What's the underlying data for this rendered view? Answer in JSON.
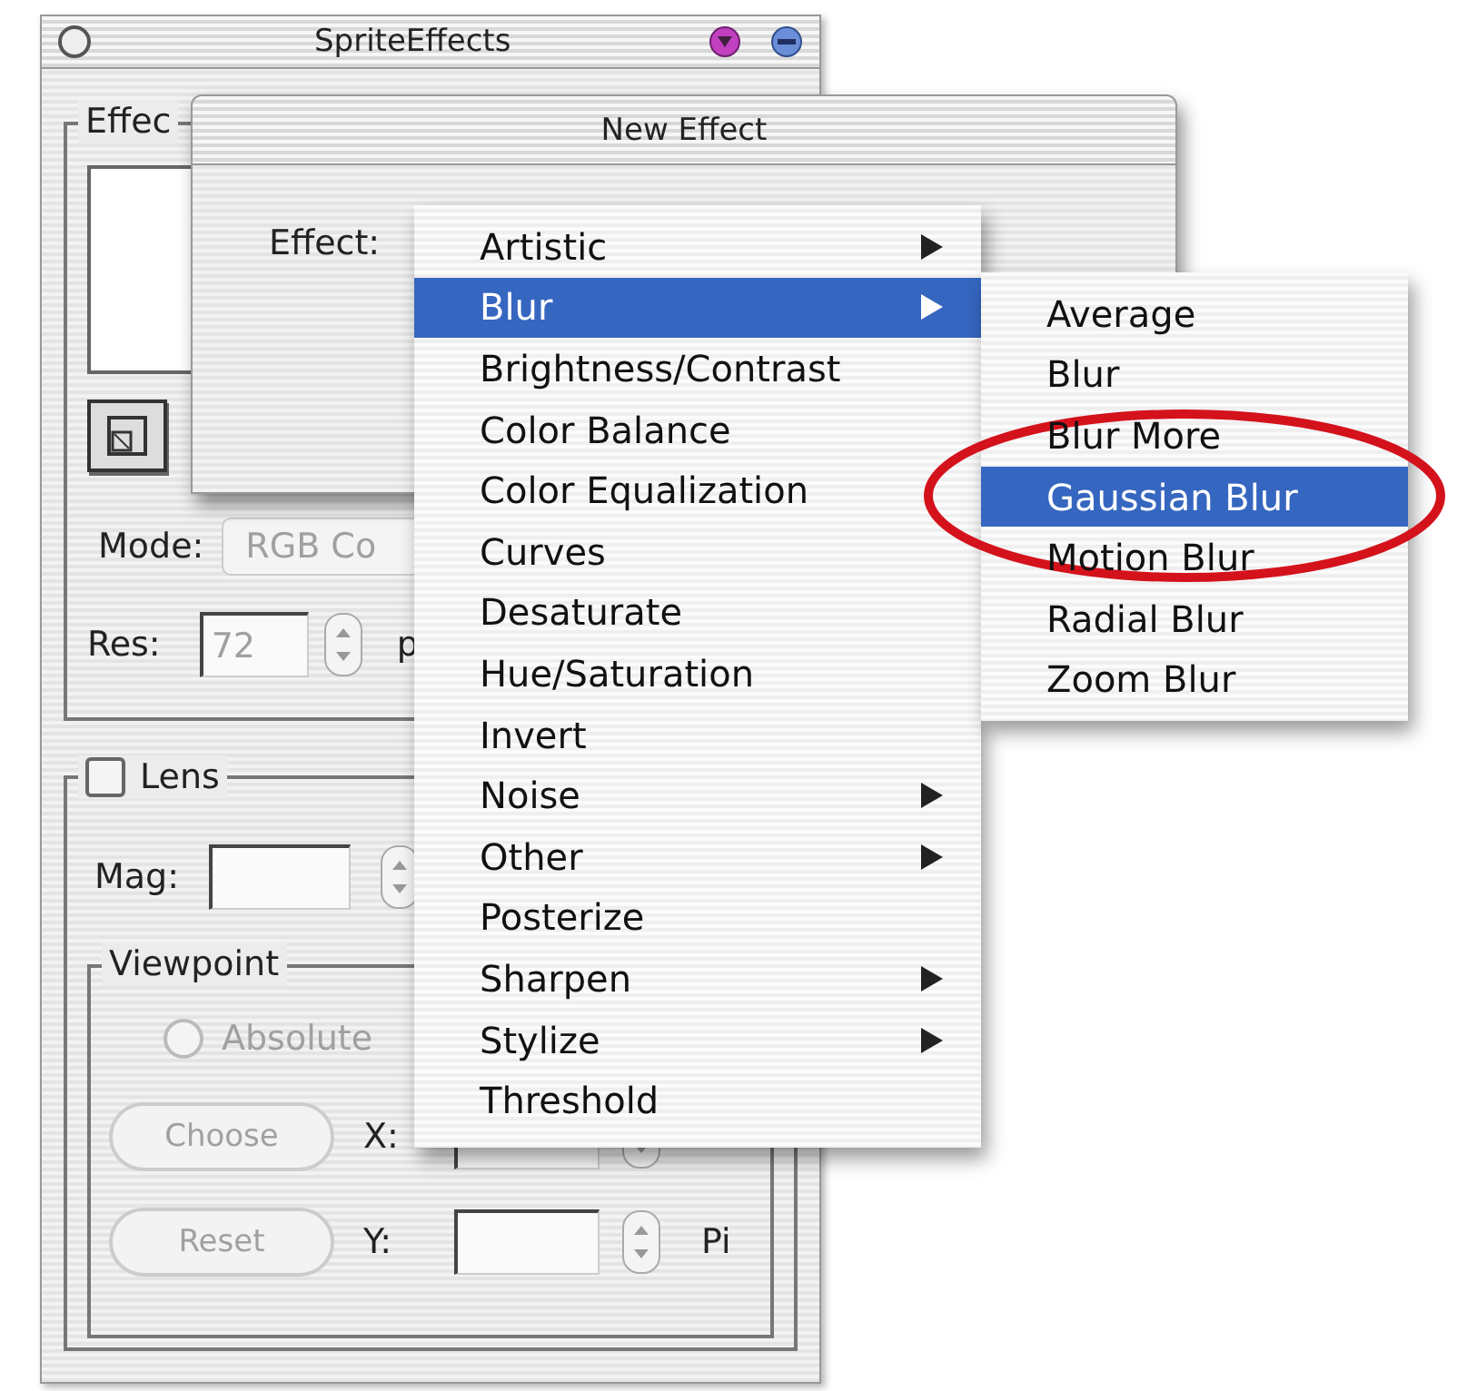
{
  "main_window": {
    "title": "SpriteEffects",
    "effect_group": {
      "label": "Effec"
    },
    "mode": {
      "label": "Mode:",
      "value": "RGB Co",
      "disabled": true
    },
    "res": {
      "label": "Res:",
      "value": "72",
      "unit": "p",
      "disabled": true
    },
    "lens": {
      "label": "Lens",
      "checked": false
    },
    "mag": {
      "label": "Mag:"
    },
    "viewpoint": {
      "label": "Viewpoint",
      "absolute": {
        "label": "Absolute",
        "selected": false,
        "disabled": true
      },
      "rows": [
        {
          "button": "Choose",
          "disabled": true,
          "axis": "X:"
        },
        {
          "button": "Reset",
          "disabled": true,
          "axis": "Y:",
          "unit": "Pi"
        }
      ]
    }
  },
  "dialog": {
    "title": "New Effect",
    "effect_label": "Effect:"
  },
  "menu": {
    "items": [
      {
        "label": "Artistic",
        "selected": false,
        "has_submenu": true
      },
      {
        "label": "Blur",
        "selected": true,
        "has_submenu": true
      },
      {
        "label": "Brightness/Contrast",
        "selected": false,
        "has_submenu": false
      },
      {
        "label": "Color Balance",
        "selected": false,
        "has_submenu": false
      },
      {
        "label": "Color Equalization",
        "selected": false,
        "has_submenu": false
      },
      {
        "label": "Curves",
        "selected": false,
        "has_submenu": false
      },
      {
        "label": "Desaturate",
        "selected": false,
        "has_submenu": false
      },
      {
        "label": "Hue/Saturation",
        "selected": false,
        "has_submenu": false
      },
      {
        "label": "Invert",
        "selected": false,
        "has_submenu": false
      },
      {
        "label": "Noise",
        "selected": false,
        "has_submenu": true
      },
      {
        "label": "Other",
        "selected": false,
        "has_submenu": true
      },
      {
        "label": "Posterize",
        "selected": false,
        "has_submenu": false
      },
      {
        "label": "Sharpen",
        "selected": false,
        "has_submenu": true
      },
      {
        "label": "Stylize",
        "selected": false,
        "has_submenu": true
      },
      {
        "label": "Threshold",
        "selected": false,
        "has_submenu": false
      }
    ]
  },
  "submenu": {
    "items": [
      {
        "label": "Average",
        "selected": false
      },
      {
        "label": "Blur",
        "selected": false
      },
      {
        "label": "Blur More",
        "selected": false
      },
      {
        "label": "Gaussian Blur",
        "selected": true
      },
      {
        "label": "Motion Blur",
        "selected": false
      },
      {
        "label": "Radial Blur",
        "selected": false
      },
      {
        "label": "Zoom Blur",
        "selected": false
      }
    ]
  }
}
